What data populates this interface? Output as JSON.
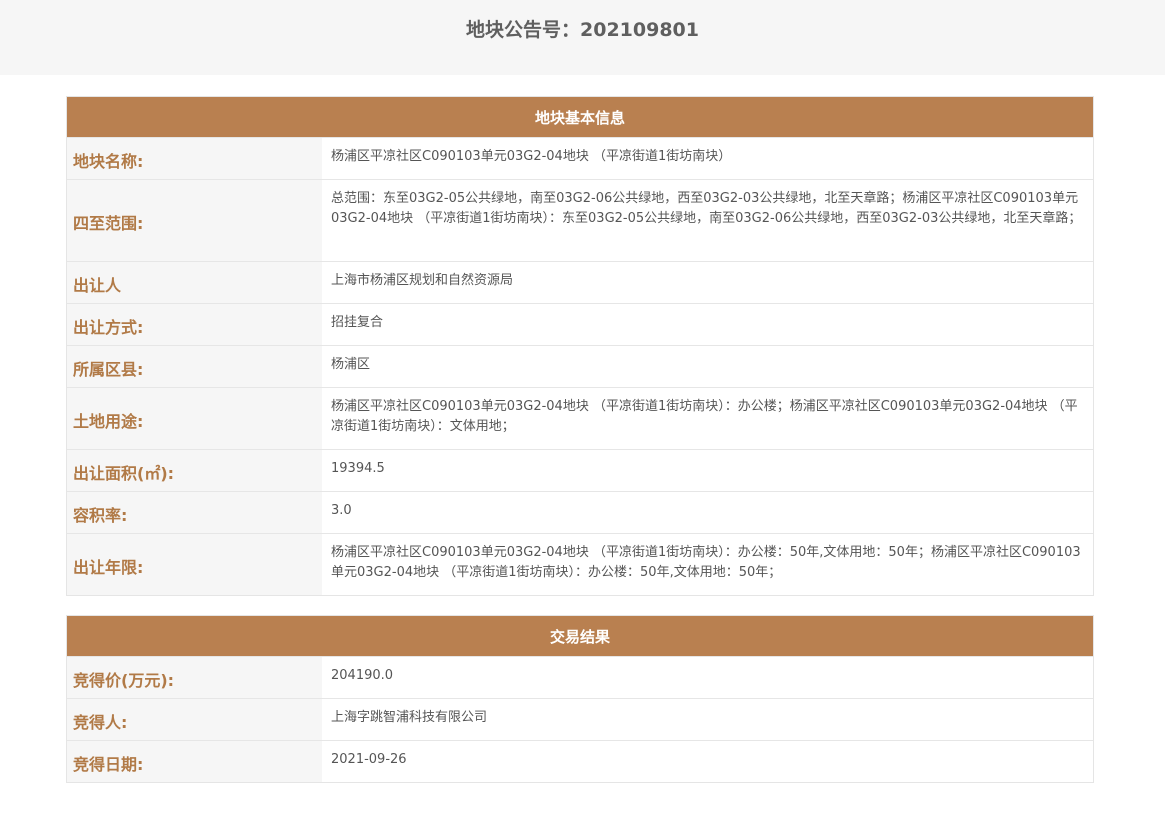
{
  "header": {
    "title": "地块公告号：202109801"
  },
  "basic_info": {
    "title": "地块基本信息",
    "rows": [
      {
        "label": "地块名称:",
        "value": "杨浦区平凉社区C090103单元03G2-04地块 （平凉街道1街坊南块）"
      },
      {
        "label": "四至范围:",
        "value": "总范围：东至03G2-05公共绿地，南至03G2-06公共绿地，西至03G2-03公共绿地，北至天章路；杨浦区平凉社区C090103单元03G2-04地块 （平凉街道1街坊南块）：东至03G2-05公共绿地，南至03G2-06公共绿地，西至03G2-03公共绿地，北至天章路；"
      },
      {
        "label": "出让人",
        "value": "上海市杨浦区规划和自然资源局"
      },
      {
        "label": "出让方式:",
        "value": "招挂复合"
      },
      {
        "label": "所属区县:",
        "value": "杨浦区"
      },
      {
        "label": "土地用途:",
        "value": "杨浦区平凉社区C090103单元03G2-04地块 （平凉街道1街坊南块）：办公楼；杨浦区平凉社区C090103单元03G2-04地块 （平凉街道1街坊南块）：文体用地；"
      },
      {
        "label": "出让面积(㎡):",
        "value": "19394.5"
      },
      {
        "label": "容积率:",
        "value": "3.0"
      },
      {
        "label": "出让年限:",
        "value": "杨浦区平凉社区C090103单元03G2-04地块 （平凉街道1街坊南块）：办公楼：50年,文体用地：50年；杨浦区平凉社区C090103单元03G2-04地块 （平凉街道1街坊南块）：办公楼：50年,文体用地：50年；"
      }
    ]
  },
  "trade_result": {
    "title": "交易结果",
    "rows": [
      {
        "label": "竞得价(万元):",
        "value": "204190.0"
      },
      {
        "label": "竞得人:",
        "value": "上海字跳智浦科技有限公司"
      },
      {
        "label": "竞得日期:",
        "value": "2021-09-26"
      }
    ]
  }
}
